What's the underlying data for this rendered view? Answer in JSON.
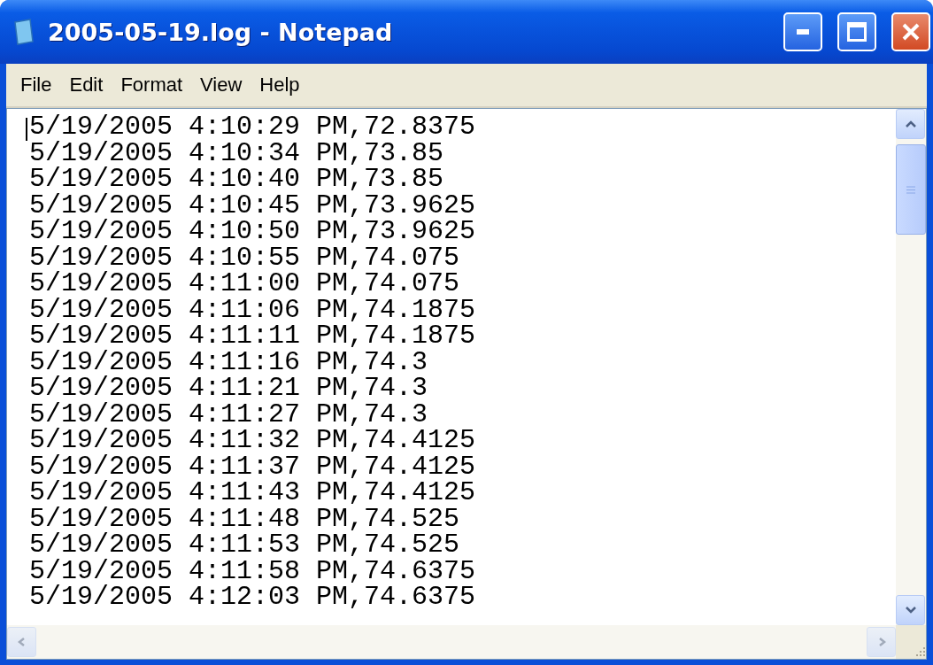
{
  "window": {
    "title": "2005-05-19.log - Notepad"
  },
  "menu": [
    "File",
    "Edit",
    "Format",
    "View",
    "Help"
  ],
  "lines": [
    "5/19/2005 4:10:29 PM,72.8375",
    "5/19/2005 4:10:34 PM,73.85",
    "5/19/2005 4:10:40 PM,73.85",
    "5/19/2005 4:10:45 PM,73.9625",
    "5/19/2005 4:10:50 PM,73.9625",
    "5/19/2005 4:10:55 PM,74.075",
    "5/19/2005 4:11:00 PM,74.075",
    "5/19/2005 4:11:06 PM,74.1875",
    "5/19/2005 4:11:11 PM,74.1875",
    "5/19/2005 4:11:16 PM,74.3",
    "5/19/2005 4:11:21 PM,74.3",
    "5/19/2005 4:11:27 PM,74.3",
    "5/19/2005 4:11:32 PM,74.4125",
    "5/19/2005 4:11:37 PM,74.4125",
    "5/19/2005 4:11:43 PM,74.4125",
    "5/19/2005 4:11:48 PM,74.525",
    "5/19/2005 4:11:53 PM,74.525",
    "5/19/2005 4:11:58 PM,74.6375",
    "5/19/2005 4:12:03 PM,74.6375"
  ]
}
